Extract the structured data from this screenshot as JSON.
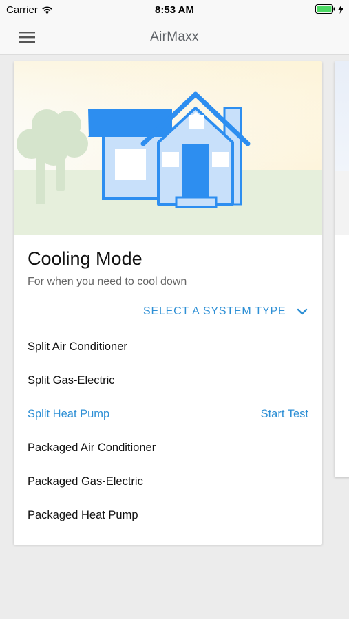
{
  "status_bar": {
    "carrier": "Carrier",
    "time": "8:53 AM",
    "wifi_icon": "wifi-icon",
    "battery_icon": "battery-icon",
    "charging_icon": "bolt-icon"
  },
  "app_bar": {
    "title": "AirMaxx",
    "menu_icon": "hamburger-menu-icon"
  },
  "card": {
    "title": "Cooling Mode",
    "subtitle": "For when you need to cool down",
    "select_label": "SELECT A SYSTEM TYPE",
    "select_icon": "chevron-down-icon",
    "illustration": "house-illustration",
    "systems": [
      {
        "label": "Split Air Conditioner",
        "active": false
      },
      {
        "label": "Split Gas-Electric",
        "active": false
      },
      {
        "label": "Split Heat Pump",
        "active": true,
        "action": "Start Test"
      },
      {
        "label": "Packaged Air Conditioner",
        "active": false
      },
      {
        "label": "Packaged Gas-Electric",
        "active": false
      },
      {
        "label": "Packaged Heat Pump",
        "active": false
      }
    ]
  },
  "colors": {
    "accent": "#2d8fd5",
    "house_blue": "#2d8ef0",
    "house_fill": "#c8e0fa",
    "ground": "#e6efdc",
    "tree": "#d5e4cc",
    "battery": "#4cd964"
  }
}
